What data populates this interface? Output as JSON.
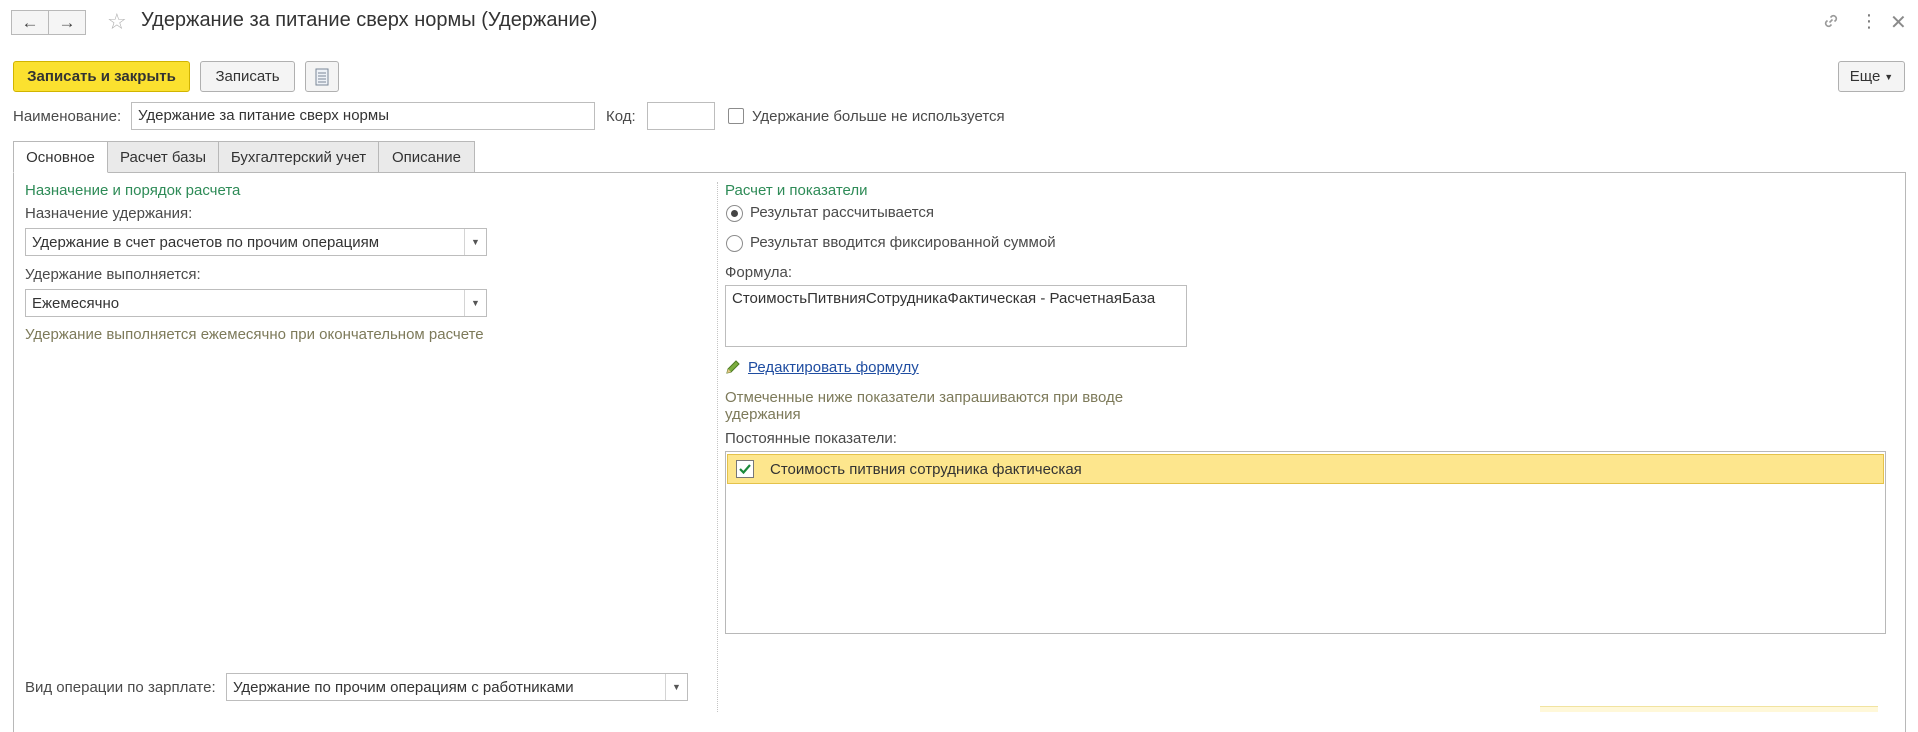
{
  "window": {
    "title": "Удержание за питание сверх нормы (Удержание)",
    "back_icon": "arrow-left-icon",
    "forward_icon": "arrow-right-icon",
    "favorite_icon": "star-icon",
    "link_icon": "link-icon",
    "menu_icon": "more-vertical-icon",
    "close_icon": "close-icon"
  },
  "toolbar": {
    "save_close_label": "Записать и закрыть",
    "save_label": "Записать",
    "more_label": "Еще",
    "report_icon": "document-icon"
  },
  "header": {
    "name_label": "Наименование:",
    "name_value": "Удержание за питание сверх нормы",
    "code_label": "Код:",
    "code_value": "",
    "unused_label": "Удержание больше не используется",
    "unused_checked": false
  },
  "tabs": [
    {
      "label": "Основное",
      "active": true
    },
    {
      "label": "Расчет базы",
      "active": false
    },
    {
      "label": "Бухгалтерский учет",
      "active": false
    },
    {
      "label": "Описание",
      "active": false
    }
  ],
  "left": {
    "group_title": "Назначение и порядок расчета",
    "purpose_label": "Назначение удержания:",
    "purpose_value": "Удержание в счет расчетов по прочим операциям",
    "schedule_label": "Удержание выполняется:",
    "schedule_value": "Ежемесячно",
    "schedule_hint": "Удержание выполняется ежемесячно при окончательном расчете",
    "operation_label": "Вид операции по зарплате:",
    "operation_value": "Удержание по прочим операциям с работниками"
  },
  "right": {
    "group_title": "Расчет и показатели",
    "radio_calculated": "Результат рассчитывается",
    "radio_fixed": "Результат вводится фиксированной суммой",
    "selected_radio": "calculated",
    "formula_label": "Формула:",
    "formula_value": "СтоимостьПитвнияСотрудникаФактическая - РасчетнаяБаза",
    "edit_formula_link": "Редактировать формулу",
    "edit_icon": "pencil-icon",
    "indicators_hint_line1": "Отмеченные ниже показатели запрашиваются при вводе",
    "indicators_hint_line2": "удержания",
    "constant_label": "Постоянные показатели:",
    "indicators": [
      {
        "label": "Стоимость питвния сотрудника фактическая",
        "checked": true
      }
    ]
  },
  "colors": {
    "accent": "#fbe12f",
    "group_title": "#2e8b57",
    "hint": "#7d7a5a",
    "selected_row": "#fde68d",
    "link": "#1f4da1"
  }
}
